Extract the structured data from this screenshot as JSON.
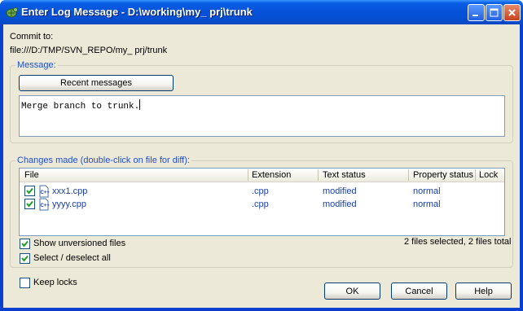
{
  "window": {
    "title": "Enter Log Message - D:\\working\\my_ prj\\trunk"
  },
  "commit": {
    "label": "Commit to:",
    "url": "file:///D:/TMP/SVN_REPO/my_ prj/trunk"
  },
  "message_group": {
    "label": "Message:",
    "recent_button": "Recent messages",
    "text": "Merge branch to trunk."
  },
  "changes_group": {
    "label": "Changes made (double-click on file for diff):",
    "columns": [
      "File",
      "Extension",
      "Text status",
      "Property status",
      "Lock"
    ],
    "rows": [
      {
        "file": "xxx1.cpp",
        "extension": ".cpp",
        "text_status": "modified",
        "property_status": "normal",
        "checked": true
      },
      {
        "file": "yyyy.cpp",
        "extension": ".cpp",
        "text_status": "modified",
        "property_status": "normal",
        "checked": true
      }
    ],
    "show_unversioned": "Show unversioned files",
    "select_all": "Select / deselect all",
    "selection_status": "2 files selected, 2 files total"
  },
  "options": {
    "keep_locks": "Keep locks"
  },
  "buttons": {
    "ok": "OK",
    "cancel": "Cancel",
    "help": "Help"
  },
  "colors": {
    "titlebar": "#0553d9",
    "dialog_bg": "#ece9d8",
    "group_label": "#1f4fc8"
  }
}
